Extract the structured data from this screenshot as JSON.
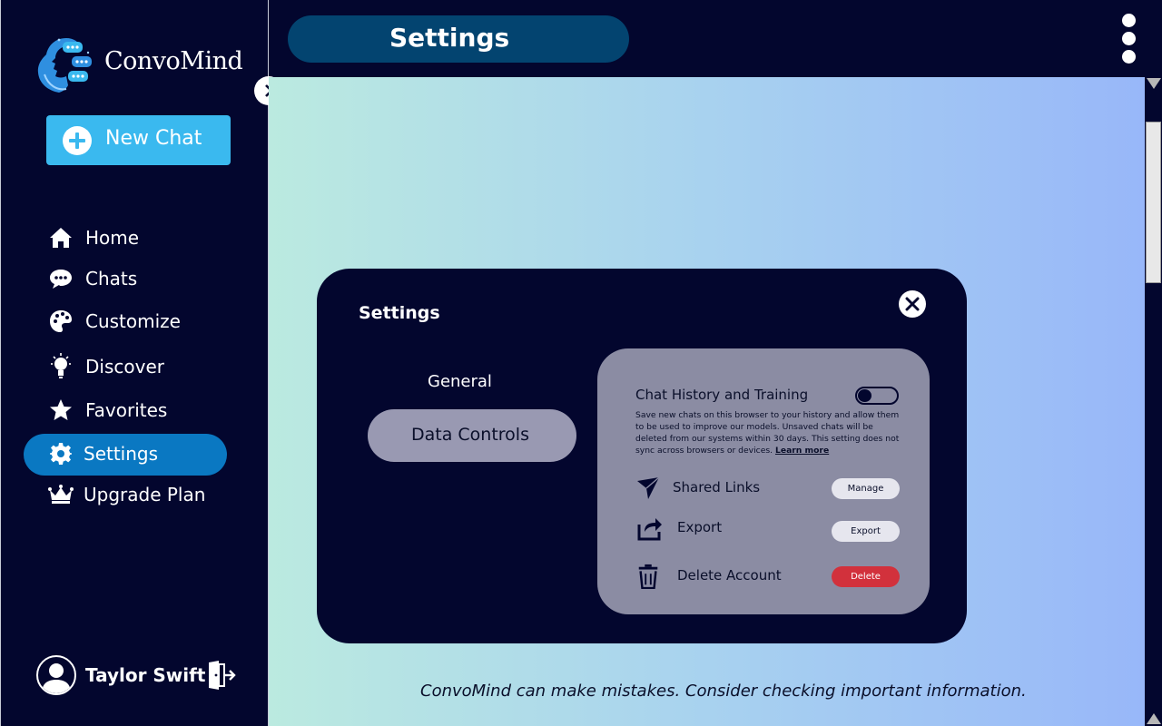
{
  "app": {
    "name": "ConvoMind"
  },
  "sidebar": {
    "new_chat_label": "New Chat",
    "items": [
      {
        "label": "Home",
        "icon": "home-icon"
      },
      {
        "label": "Chats",
        "icon": "chat-bubble-icon"
      },
      {
        "label": "Customize",
        "icon": "palette-icon"
      },
      {
        "label": "Discover",
        "icon": "lightbulb-icon"
      },
      {
        "label": "Favorites",
        "icon": "star-icon"
      },
      {
        "label": "Settings",
        "icon": "gear-icon",
        "active": true
      },
      {
        "label": "Upgrade Plan",
        "icon": "crown-icon"
      }
    ],
    "user": {
      "name": "Taylor Swift"
    }
  },
  "header": {
    "title": "Settings"
  },
  "modal": {
    "title": "Settings",
    "tabs": [
      {
        "label": "General",
        "active": false
      },
      {
        "label": "Data Controls",
        "active": true
      }
    ],
    "data_controls": {
      "chat_history": {
        "label": "Chat History and Training",
        "enabled": false,
        "description": "Save new chats on this browser to your history and allow them to be used to improve our models. Unsaved chats will be deleted from our systems within 30 days. This setting does not sync across browsers or devices.",
        "link": "Learn more"
      },
      "rows": [
        {
          "label": "Shared Links",
          "button": "Manage",
          "icon": "send-icon"
        },
        {
          "label": "Export",
          "button": "Export",
          "icon": "share-icon"
        },
        {
          "label": "Delete Account",
          "button": "Delete",
          "icon": "trash-icon"
        }
      ]
    }
  },
  "footer": {
    "disclaimer": "ConvoMind can make mistakes. Consider checking important information."
  },
  "colors": {
    "sidebar_bg": "#03062e",
    "accent": "#3ab9ef",
    "active_nav": "#0a78c2",
    "title_pill": "#034470",
    "danger": "#d2313c"
  }
}
